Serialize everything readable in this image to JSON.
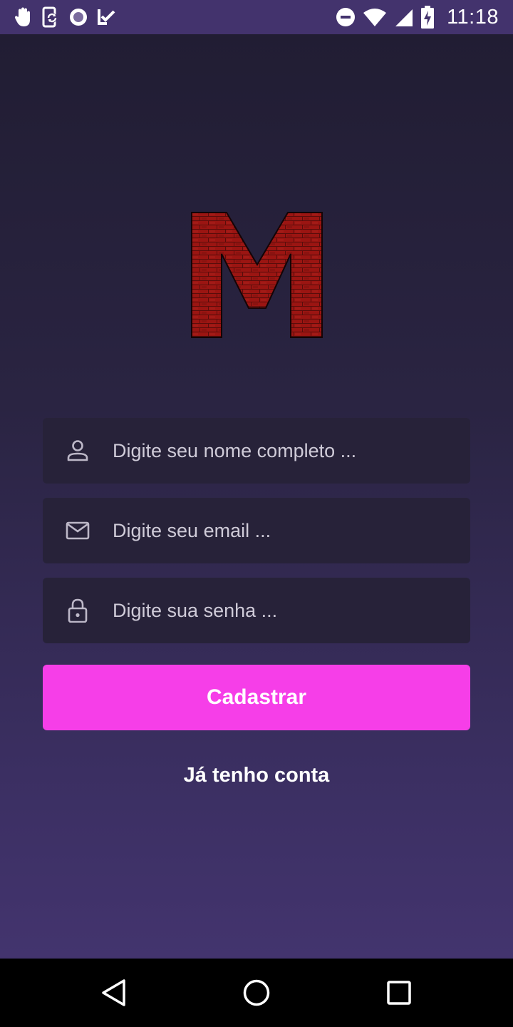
{
  "status_bar": {
    "time": "11:18",
    "left_icons": [
      "hand-icon",
      "sync-phone-icon",
      "record-icon",
      "check-icon"
    ],
    "right_icons": [
      "dnd-icon",
      "wifi-icon",
      "signal-icon",
      "battery-charging-icon"
    ]
  },
  "logo": {
    "icon": "brick-m-logo-icon",
    "colors": {
      "brick": "#9b1512",
      "mortar": "#5a0d0b",
      "outline": "#140406"
    }
  },
  "form": {
    "name_placeholder": "Digite seu nome completo ...",
    "email_placeholder": "Digite seu email ...",
    "password_placeholder": "Digite sua senha ...",
    "submit_label": "Cadastrar",
    "login_link": "Já tenho conta"
  },
  "nav_bar": {
    "icons": [
      "back-icon",
      "home-icon",
      "recents-icon"
    ]
  },
  "colors": {
    "accent": "#f63ee8",
    "status_bar": "#43336d",
    "field_bg": "#272239",
    "background_top": "#211d33",
    "background_bottom": "#43346e"
  }
}
